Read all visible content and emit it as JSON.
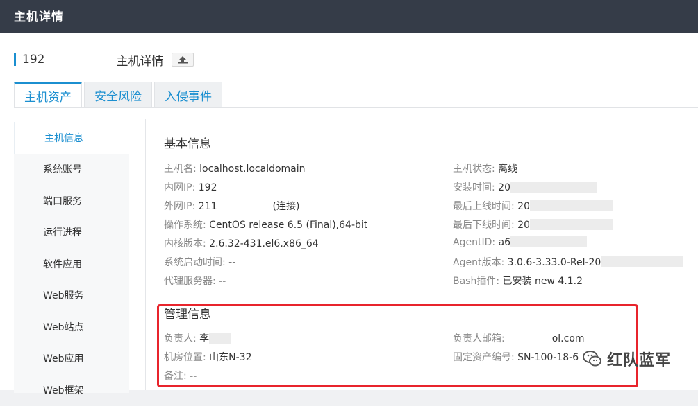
{
  "topbar": {
    "title": "主机详情"
  },
  "host": {
    "ip": "192",
    "title": "主机详情"
  },
  "tabs": [
    {
      "label": "主机资产",
      "active": true
    },
    {
      "label": "安全风险",
      "active": false
    },
    {
      "label": "入侵事件",
      "active": false
    }
  ],
  "sidebar": {
    "items": [
      {
        "label": "主机信息",
        "active": true
      },
      {
        "label": "系统账号"
      },
      {
        "label": "端口服务"
      },
      {
        "label": "运行进程"
      },
      {
        "label": "软件应用"
      },
      {
        "label": "Web服务"
      },
      {
        "label": "Web站点"
      },
      {
        "label": "Web应用"
      },
      {
        "label": "Web框架"
      }
    ]
  },
  "basic": {
    "title": "基本信息",
    "left": [
      {
        "label": "主机名:",
        "value": "localhost.localdomain"
      },
      {
        "label": "内网IP:",
        "value": "192"
      },
      {
        "label": "外网IP:",
        "value": "211",
        "suffix": "(连接)"
      },
      {
        "label": "操作系统:",
        "value": "CentOS release 6.5 (Final),64-bit"
      },
      {
        "label": "内核版本:",
        "value": "2.6.32-431.el6.x86_64"
      },
      {
        "label": "系统启动时间:",
        "value": "--"
      },
      {
        "label": "代理服务器:",
        "value": "--"
      }
    ],
    "right": [
      {
        "label": "主机状态:",
        "value": "离线"
      },
      {
        "label": "安装时间:",
        "value": "20"
      },
      {
        "label": "最后上线时间:",
        "value": "20"
      },
      {
        "label": "最后下线时间:",
        "value": "20"
      },
      {
        "label": "AgentID:",
        "value": "a6"
      },
      {
        "label": "Agent版本:",
        "value": "3.0.6-3.33.0-Rel-20"
      },
      {
        "label": "Bash插件:",
        "value": "已安装 new 4.1.2"
      }
    ]
  },
  "mgmt": {
    "title": "管理信息",
    "owner": {
      "label": "负责人:",
      "value": "李"
    },
    "room": {
      "label": "机房位置:",
      "value": "山东N-32"
    },
    "note": {
      "label": "备注:",
      "value": "--"
    },
    "email": {
      "label": "负责人邮箱:",
      "value": "ol.com"
    },
    "asset": {
      "label": "固定资产编号:",
      "value": "SN-100-18-6"
    }
  },
  "watermark": {
    "text": "红队蓝军",
    "icon": "wechat-icon"
  },
  "colors": {
    "accent": "#1b8fd0",
    "topbar": "#353c48",
    "highlight": "#e8242c"
  }
}
